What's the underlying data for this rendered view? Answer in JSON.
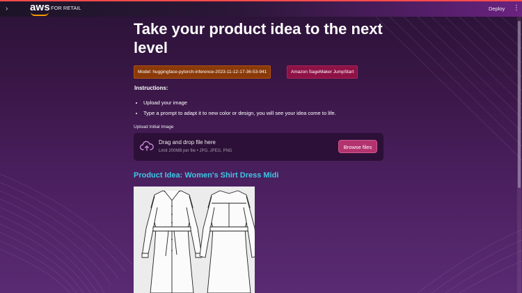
{
  "header": {
    "brand": "aws",
    "brand_suffix": "FOR RETAIL",
    "deploy_label": "Deploy",
    "menu_icon": "kebab-menu-icon",
    "sidebar_toggle_icon": "chevron-right-icon"
  },
  "main": {
    "title": "Take your product idea to the next level",
    "tags": {
      "model": "Model: huggingface-pytorch-inference-2023-11-12-17-36-53-941",
      "platform": "Amazon SageMaker JumpStart"
    },
    "instructions_heading": "Instructions:",
    "instructions": [
      "Upload your image",
      "Type a prompt to adapt it to new color or design, you will see your idea come to life."
    ],
    "upload": {
      "label": "Upload Initial Image",
      "drop_text": "Drag and drop file here",
      "limit_text": "Limit 200MB per file • JPG, JPEG, PNG",
      "browse_label": "Browse files",
      "icon": "cloud-upload-icon"
    },
    "product_heading": "Product Idea: Women's Shirt Dress Midi",
    "product_image": "shirt-dress-sketch"
  },
  "colors": {
    "accent_bar": "#ff4b4b",
    "model_tag": "#8a3a08",
    "platform_tag": "#8e1246",
    "browse_button": "#b3336f",
    "heading_cyan": "#3fc6e6"
  }
}
